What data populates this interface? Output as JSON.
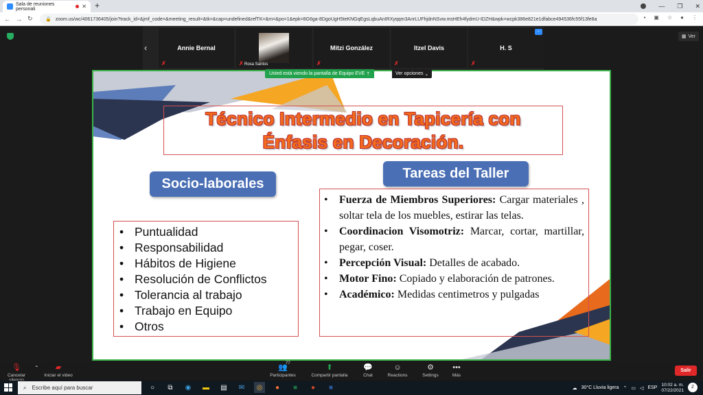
{
  "browser": {
    "tab_title": "Sala de reuniones personali",
    "tab_close": "✕",
    "new_tab": "+",
    "url": "zoom.us/wc/4061736405/join?track_id=&jmf_code=&meeting_result=&tk=&cap=undefined&refTK=&m=&po=1&epk=8G6ga-8DgoUgH5teKNGqEgsLqbuAnIRXyqqm3AnrLUFhjdnNSvw.msHEh4fydmU-IDZH&wpk=wcpk386e821e1dfabce494536fc55f13fe8a",
    "win_min": "—",
    "win_max": "❐",
    "win_close": "✕"
  },
  "meeting": {
    "participants": [
      {
        "name": "Annie Bernal",
        "muted": true
      },
      {
        "name": "Rosa Santos",
        "muted": true,
        "has_video": true
      },
      {
        "name": "Mitzi González",
        "muted": true
      },
      {
        "name": "Itzel Davis",
        "muted": true
      },
      {
        "name": "H. S",
        "muted": true
      }
    ],
    "view_label": "Ver",
    "share_banner": "Usted está viendo la pantalla de Equipo EVE",
    "view_options": "Ver opciones"
  },
  "slide": {
    "title_line1": "Técnico Intermedio en Tapicería con",
    "title_line2": "Énfasis en Decoración.",
    "left_heading": "Socio-laborales",
    "right_heading": "Tareas del Taller",
    "left_items": [
      "Puntualidad",
      "Responsabilidad",
      "Hábitos de Higiene",
      "Resolución de Conflictos",
      "Tolerancia al trabajo",
      "Trabajo en Equipo",
      "Otros"
    ],
    "right_items": [
      {
        "bold": "Fuerza de  Miembros Superiores:",
        "text": " Cargar materiales , soltar tela de los muebles, estirar las telas."
      },
      {
        "bold": "Coordinacion Visomotriz:",
        "text": "  Marcar, cortar, martillar, pegar, coser."
      },
      {
        "bold": "Percepción Visual:",
        "text": "  Detalles de acabado."
      },
      {
        "bold": "Motor Fino:",
        "text": "  Copiado y elaboración de patrones."
      },
      {
        "bold": "Académico:",
        "text": " Medidas centimetros y pulgadas"
      }
    ],
    "bullet": "•",
    "colors": {
      "title": "#f36b1c",
      "pill": "#4a6fb5",
      "border": "#d45050",
      "accent_orange": "#f5a623",
      "accent_navy": "#2c3550"
    }
  },
  "toolbar": {
    "mute_label": "Cancelar silencio",
    "video_label": "Iniciar el video",
    "participants_label": "Participantes",
    "participants_count": "77",
    "share_label": "Compartir pantalla",
    "chat_label": "Chat",
    "reactions_label": "Reactions",
    "settings_label": "Settings",
    "more_label": "Más",
    "leave_label": "Salir"
  },
  "taskbar": {
    "search_placeholder": "Escribe aquí para buscar",
    "weather": "30°C  Lluvia ligera",
    "lang": "ESP",
    "time": "10:02 a. m.",
    "date": "07/22/2021",
    "notif": "2"
  }
}
